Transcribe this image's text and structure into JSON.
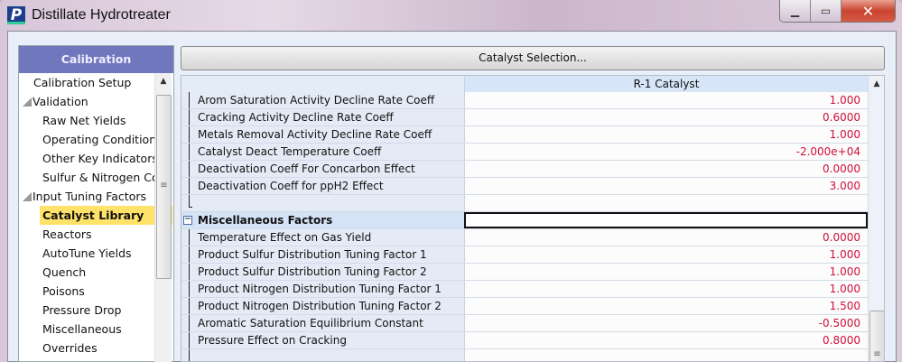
{
  "window": {
    "title": "Distillate Hydrotreater",
    "logo": "P",
    "minimize": "▁",
    "maximize": "▭",
    "close": "✕"
  },
  "sidebar": {
    "header": "Calibration",
    "items": [
      {
        "label": "Calibration Setup",
        "level": "l0"
      },
      {
        "label": "Validation",
        "level": "g",
        "group": true
      },
      {
        "label": "Raw Net Yields",
        "level": "l1"
      },
      {
        "label": "Operating Condition",
        "level": "l1"
      },
      {
        "label": "Other Key Indicators",
        "level": "l1"
      },
      {
        "label": "Sulfur & Nitrogen Co",
        "level": "l1"
      },
      {
        "label": "Input Tuning Factors",
        "level": "g",
        "group": true
      },
      {
        "label": "Catalyst Library",
        "level": "sel",
        "selected": true
      },
      {
        "label": "Reactors",
        "level": "l1"
      },
      {
        "label": "AutoTune Yields",
        "level": "l1"
      },
      {
        "label": "Quench",
        "level": "l1"
      },
      {
        "label": "Poisons",
        "level": "l1"
      },
      {
        "label": "Pressure Drop",
        "level": "l1"
      },
      {
        "label": "Miscellaneous",
        "level": "l1"
      },
      {
        "label": "Overrides",
        "level": "l1"
      }
    ]
  },
  "main": {
    "catalyst_button": "Catalyst Selection...",
    "column_header": "R-1 Catalyst",
    "rows": [
      {
        "label": "Arom Saturation Activity Decline Rate Coeff",
        "value": "1.000"
      },
      {
        "label": "Cracking Activity Decline Rate Coeff",
        "value": "0.6000"
      },
      {
        "label": "Metals Removal Activity Decline Rate Coeff",
        "value": "1.000"
      },
      {
        "label": "Catalyst Deact Temperature Coeff",
        "value": "-2.000e+04"
      },
      {
        "label": "Deactivation Coeff For Concarbon Effect",
        "value": "0.0000"
      },
      {
        "label": "Deactivation Coeff for ppH2 Effect",
        "value": "3.000"
      },
      {
        "label": "",
        "value": "",
        "type": "last"
      },
      {
        "label": "Miscellaneous Factors",
        "value": "",
        "type": "hd"
      },
      {
        "label": "Temperature Effect on Gas Yield",
        "value": "0.0000"
      },
      {
        "label": "Product Sulfur Distribution Tuning Factor 1",
        "value": "1.000"
      },
      {
        "label": "Product Sulfur Distribution Tuning Factor 2",
        "value": "1.000"
      },
      {
        "label": "Product Nitrogen Distribution Tuning Factor 1",
        "value": "1.000"
      },
      {
        "label": "Product Nitrogen Distribution Tuning Factor 2",
        "value": "1.500"
      },
      {
        "label": "Aromatic Saturation Equilibrium Constant",
        "value": "-0.5000"
      },
      {
        "label": "Pressure Effect on Cracking",
        "value": "0.8000"
      },
      {
        "label": "",
        "value": "",
        "type": "last"
      }
    ]
  },
  "colors": {
    "value_text": "#d0103a",
    "sidebar_header": "#7177bc",
    "selected": "#fee26a"
  }
}
